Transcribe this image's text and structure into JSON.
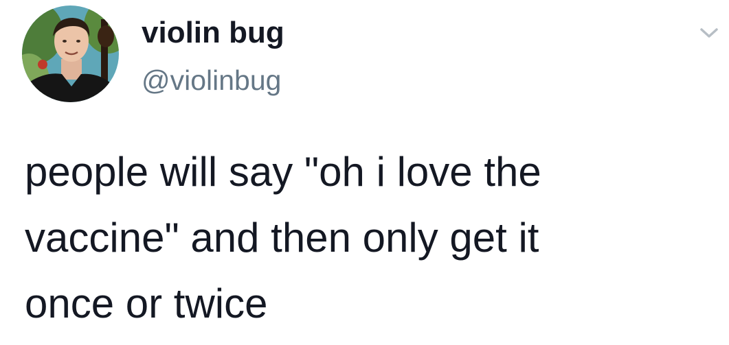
{
  "author": {
    "display_name": "violin bug",
    "handle": "@violinbug",
    "avatar_icon": "profile-photo"
  },
  "tweet": {
    "text_lines": [
      "people will say \"oh i love the",
      "vaccine\" and then only get it",
      "once or twice"
    ]
  },
  "menu": {
    "icon": "chevron-down-icon"
  },
  "colors": {
    "name": "#141823",
    "handle": "#657786",
    "chevron": "#b7bec5"
  }
}
